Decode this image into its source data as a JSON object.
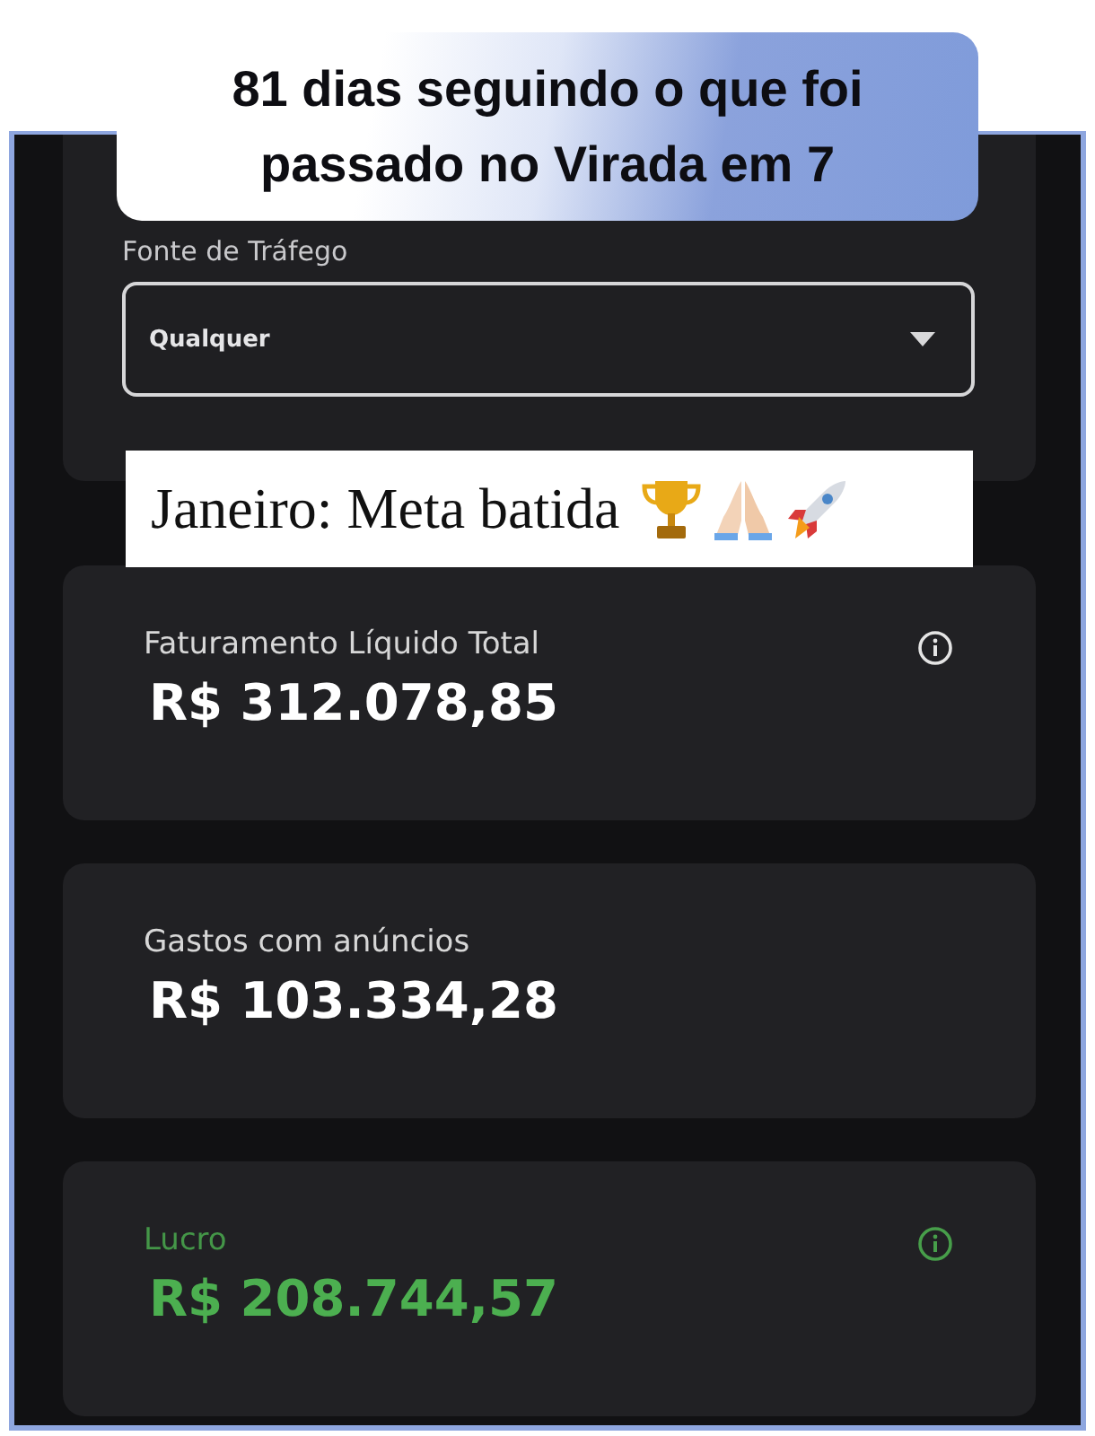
{
  "caption": {
    "lines": [
      "81 dias seguindo o que foi",
      "passado no Virada em 7"
    ]
  },
  "filter": {
    "label": "Fonte de Tráfego",
    "value": "Qualquer"
  },
  "sticker": {
    "text": "Janeiro: Meta batida"
  },
  "metrics": [
    {
      "label": "Faturamento Líquido Total",
      "value": "R$ 312.078,85",
      "info": true,
      "color": "#ffffff"
    },
    {
      "label": "Gastos com anúncios",
      "value": "R$ 103.334,28",
      "info": false,
      "color": "#ffffff"
    },
    {
      "label": "Lucro",
      "value": "R$ 208.744,57",
      "info": true,
      "color": "#4caf50"
    }
  ]
}
